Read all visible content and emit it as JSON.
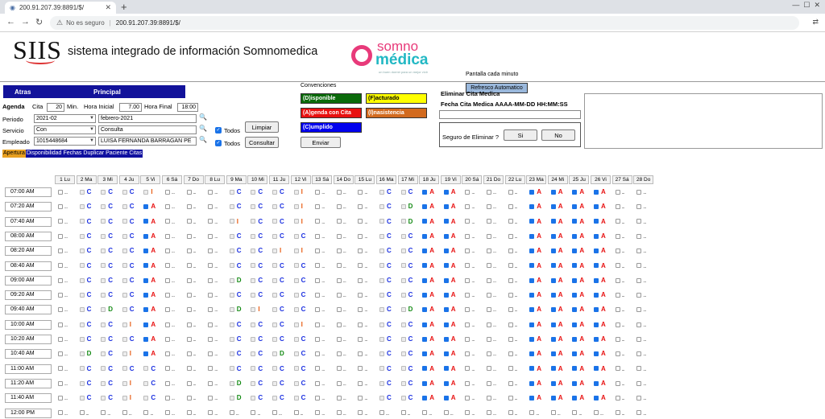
{
  "browser": {
    "tab_title": "200.91.207.39:8891/$/",
    "not_secure": "No es seguro",
    "url": "200.91.207.39:8891/$/"
  },
  "header": {
    "logo": "SIIS",
    "brand": "sistema integrado de información Somnomedica",
    "partner_top": "somno",
    "partner_bottom": "médica",
    "partner_tagline": "un buen dormir para un mejor vivir",
    "pantalla_label": "Pantalla cada minuto",
    "refresco_button": "Refresco Automatico"
  },
  "navbar": {
    "atras": "Atras",
    "principal": "Principal"
  },
  "form": {
    "agenda_label": "Agenda",
    "cita_label": "Cita",
    "cita_value": "20",
    "min_label": "Min.",
    "hora_inicial_label": "Hora Inicial",
    "hora_inicial_value": "7.00",
    "hora_final_label": "Hora Final",
    "hora_final_value": "18:00",
    "periodo_label": "Periodo",
    "periodo_value": "2021-02",
    "periodo_text": "febrero-2021",
    "servicio_label": "Servicio",
    "servicio_value": "Con",
    "servicio_text": "Consulta",
    "empleado_label": "Empleado",
    "empleado_value": "1015448684",
    "empleado_text": "LUISA FERNANDA BARRAGAN PE",
    "todos1": "Todos",
    "todos2": "Todos",
    "limpiar": "Limpiar",
    "consultar": "Consultar"
  },
  "apertura": [
    "Apertura",
    "Disponibilidad",
    "Fechas",
    "Duplicar",
    "Paciente",
    "Citas"
  ],
  "conventions": {
    "title": "Convenciones",
    "items": [
      {
        "label": "(D)isponible",
        "bg": "#0a6a0a",
        "fg": "#ffffff"
      },
      {
        "label": "(F)acturado",
        "bg": "#ffff00",
        "fg": "#000000"
      },
      {
        "label": "(A)genda con Cita",
        "bg": "#e81010",
        "fg": "#ffffff"
      },
      {
        "label": "(I)nasistencia",
        "bg": "#d26a1e",
        "fg": "#ffffff"
      },
      {
        "label": "(C)umplido",
        "bg": "#0000ee",
        "fg": "#ffffff"
      }
    ],
    "enviar": "Enviar"
  },
  "delete_panel": {
    "title": "Eliminar Cita Medica",
    "fecha_label": "Fecha Cita Medica AAAA-MM-DD HH:MM:SS",
    "seguro": "Seguro de Eliminar ?",
    "si": "Si",
    "no": "No"
  },
  "schedule": {
    "days": [
      "1 Lu",
      "2 Ma",
      "3 Mi",
      "4 Ju",
      "5 Vi",
      "6 Sá",
      "7 Do",
      "8 Lu",
      "9 Ma",
      "10 Mi",
      "11 Ju",
      "12 Vi",
      "13 Sá",
      "14 Do",
      "15 Lu",
      "16 Ma",
      "17 Mi",
      "18 Ju",
      "19 Vi",
      "20 Sá",
      "21 Do",
      "22 Lu",
      "23 Ma",
      "24 Mi",
      "25 Ju",
      "26 Vi",
      "27 Sá",
      "28 Do"
    ],
    "times": [
      "07:00 AM",
      "07:20 AM",
      "07:40 AM",
      "08:00 AM",
      "08:20 AM",
      "08:40 AM",
      "09:00 AM",
      "09:20 AM",
      "09:40 AM",
      "10:00 AM",
      "10:20 AM",
      "10:40 AM",
      "11:00 AM",
      "11:20 AM",
      "11:40 AM",
      "12:00 PM"
    ],
    "rows": [
      "-CCCI--.CCCI---CCAA---AAAA--",
      "-CCCA---CCCI---CDAA---AAAA--",
      "-CCCA---ICCI---CDAA---AAAA--",
      "-CCCA---CCCC---CCAA---AAAA--",
      "-CCCA---CCII---CCAA---AAAA--",
      "-CCCA---CCCC---CCAA---AAAA--",
      "-CCCA---DCCC---CCAA---AAAA--",
      "-CCCA---CCCC---CCAA---AAAA--",
      "-CDCA---DICC---CDAA---AAAA--",
      "-CCIA---CCCI---CCAA---AAAA--",
      "-CCCA---CCCC---CCAA---AAAA--",
      "-DCIA---CCDC---CCAA---AAAA--",
      "-CCCC---CCCC---CCAA---AAAA--",
      "-CCIC---DCCC---CCAA---AAAA--",
      "-CCIC---DCCC---CCAA---AAAA--",
      "----------------------------"
    ],
    "status_colors": {
      "C": "#1a2fe0",
      "A": "#e81010",
      "I": "#e85a10",
      "D": "#138a13"
    }
  }
}
